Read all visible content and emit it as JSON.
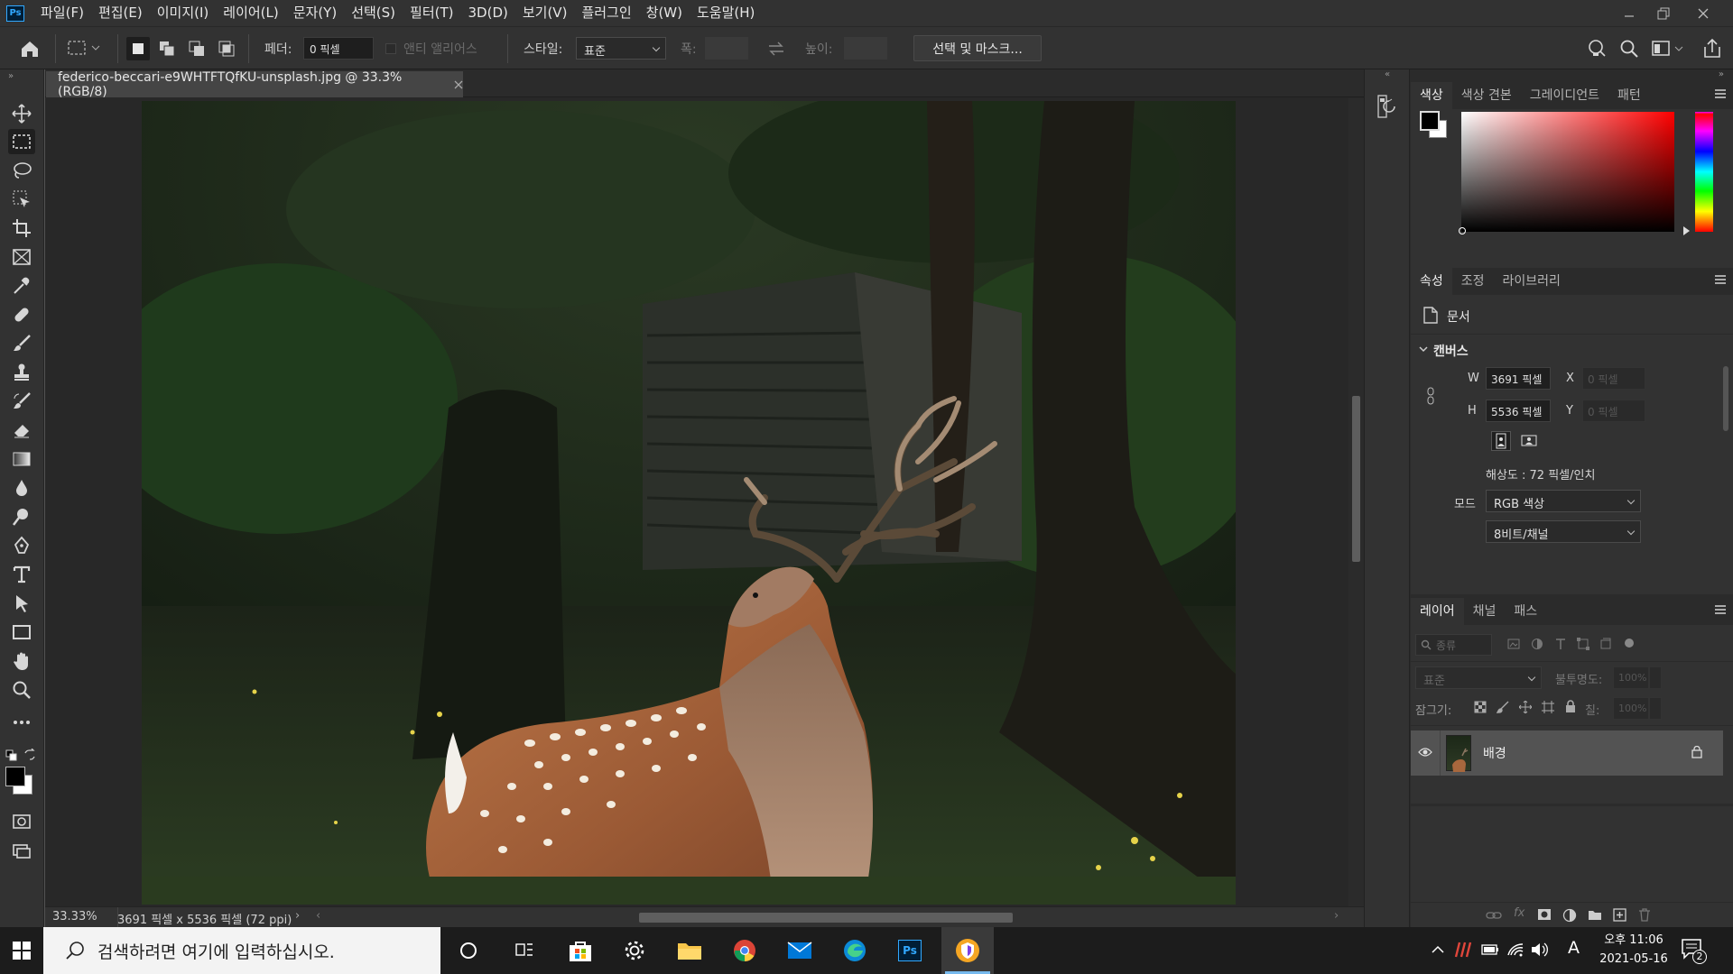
{
  "app": {
    "logo": "Ps"
  },
  "menu": [
    "파일(F)",
    "편집(E)",
    "이미지(I)",
    "레이어(L)",
    "문자(Y)",
    "선택(S)",
    "필터(T)",
    "3D(D)",
    "보기(V)",
    "플러그인",
    "창(W)",
    "도움말(H)"
  ],
  "options": {
    "feather_label": "페더:",
    "feather_value": "0 픽셀",
    "antialias_label": "앤티 앨리어스",
    "style_label": "스타일:",
    "style_value": "표준",
    "width_label": "폭:",
    "height_label": "높이:",
    "select_mask_button": "선택 및 마스크..."
  },
  "document": {
    "tab_title": "federico-beccari-e9WHTFTQfKU-unsplash.jpg @ 33.3% (RGB/8)",
    "zoom": "33.33%",
    "dimensions": "3691 픽셀 x 5536 픽셀 (72 ppi)"
  },
  "color_panel": {
    "tabs": [
      "색상",
      "색상 견본",
      "그레이디언트",
      "패턴"
    ],
    "foreground": "#000000",
    "background": "#ffffff",
    "picker_hue": "#ff0000"
  },
  "properties_panel": {
    "tabs": [
      "속성",
      "조정",
      "라이브러리"
    ],
    "doc_label": "문서",
    "section": "캔버스",
    "w_label": "W",
    "w_value": "3691 픽셀",
    "h_label": "H",
    "h_value": "5536 픽셀",
    "x_label": "X",
    "x_placeholder": "0 픽셀",
    "y_label": "Y",
    "y_placeholder": "0 픽셀",
    "resolution": "해상도 : 72 픽셀/인치",
    "mode_label": "모드",
    "mode_value": "RGB 색상",
    "depth_value": "8비트/채널"
  },
  "layers_panel": {
    "tabs": [
      "레이어",
      "채널",
      "패스"
    ],
    "filter_placeholder": "종류",
    "blend_mode": "표준",
    "opacity_label": "불투명도:",
    "opacity_value": "100%",
    "lock_label": "잠그기:",
    "fill_label": "칠:",
    "fill_value": "100%",
    "layers": [
      {
        "name": "배경",
        "visible": true,
        "locked": true
      }
    ]
  },
  "taskbar": {
    "search_placeholder": "검색하려면 여기에 입력하십시오.",
    "time": "오후 11:06",
    "date": "2021-05-16",
    "ime": "A",
    "notifications": "2"
  },
  "colors": {
    "accent": "#31a8ff",
    "panel": "#323232",
    "canvas_bg": "#282828"
  }
}
